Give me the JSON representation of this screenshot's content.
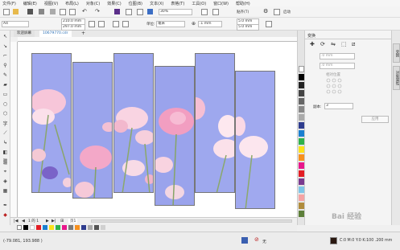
{
  "menu": [
    "文件(F)",
    "编辑(E)",
    "视图(V)",
    "布局(L)",
    "对象(C)",
    "效果(C)",
    "位图(B)",
    "文本(X)",
    "表格(T)",
    "工具(O)",
    "窗口(W)",
    "帮助(H)"
  ],
  "toolbar": {
    "zoom": "30%",
    "snap": "贴齐(T)",
    "launch": "启动"
  },
  "propbar": {
    "page_size": "A4",
    "width": "210.0 mm",
    "height": "297.0 mm",
    "unit_label": "单位:",
    "unit": "毫米",
    "nudge": ".1 mm",
    "dup_x": "5.0 mm",
    "dup_y": "5.0 mm"
  },
  "tabs": {
    "welcome": "欢迎屏幕",
    "doc": "10679770.cdr"
  },
  "docker": {
    "title": "变换",
    "x_field": ".0 mm",
    "y_field": ".0 mm",
    "rel_label": "相对位置",
    "copies_label": "副本:",
    "copies_value": "3",
    "apply": "应用"
  },
  "docktabs": {
    "t1": "变换",
    "t2": "对象属性"
  },
  "pagebar": {
    "page_count": "1 的 1",
    "page_tab": "页1"
  },
  "status": {
    "coords": "(-79.081, 193.988 )",
    "fill_none": "无",
    "color_info": "C:0 M:0 Y:0 K:100 .200 mm"
  },
  "watermark": "Bai  经验",
  "colors": {
    "accent": "#2a6fb5",
    "strip_sky": "#9ba6ee",
    "flower_pink": "#f6b4cf"
  }
}
